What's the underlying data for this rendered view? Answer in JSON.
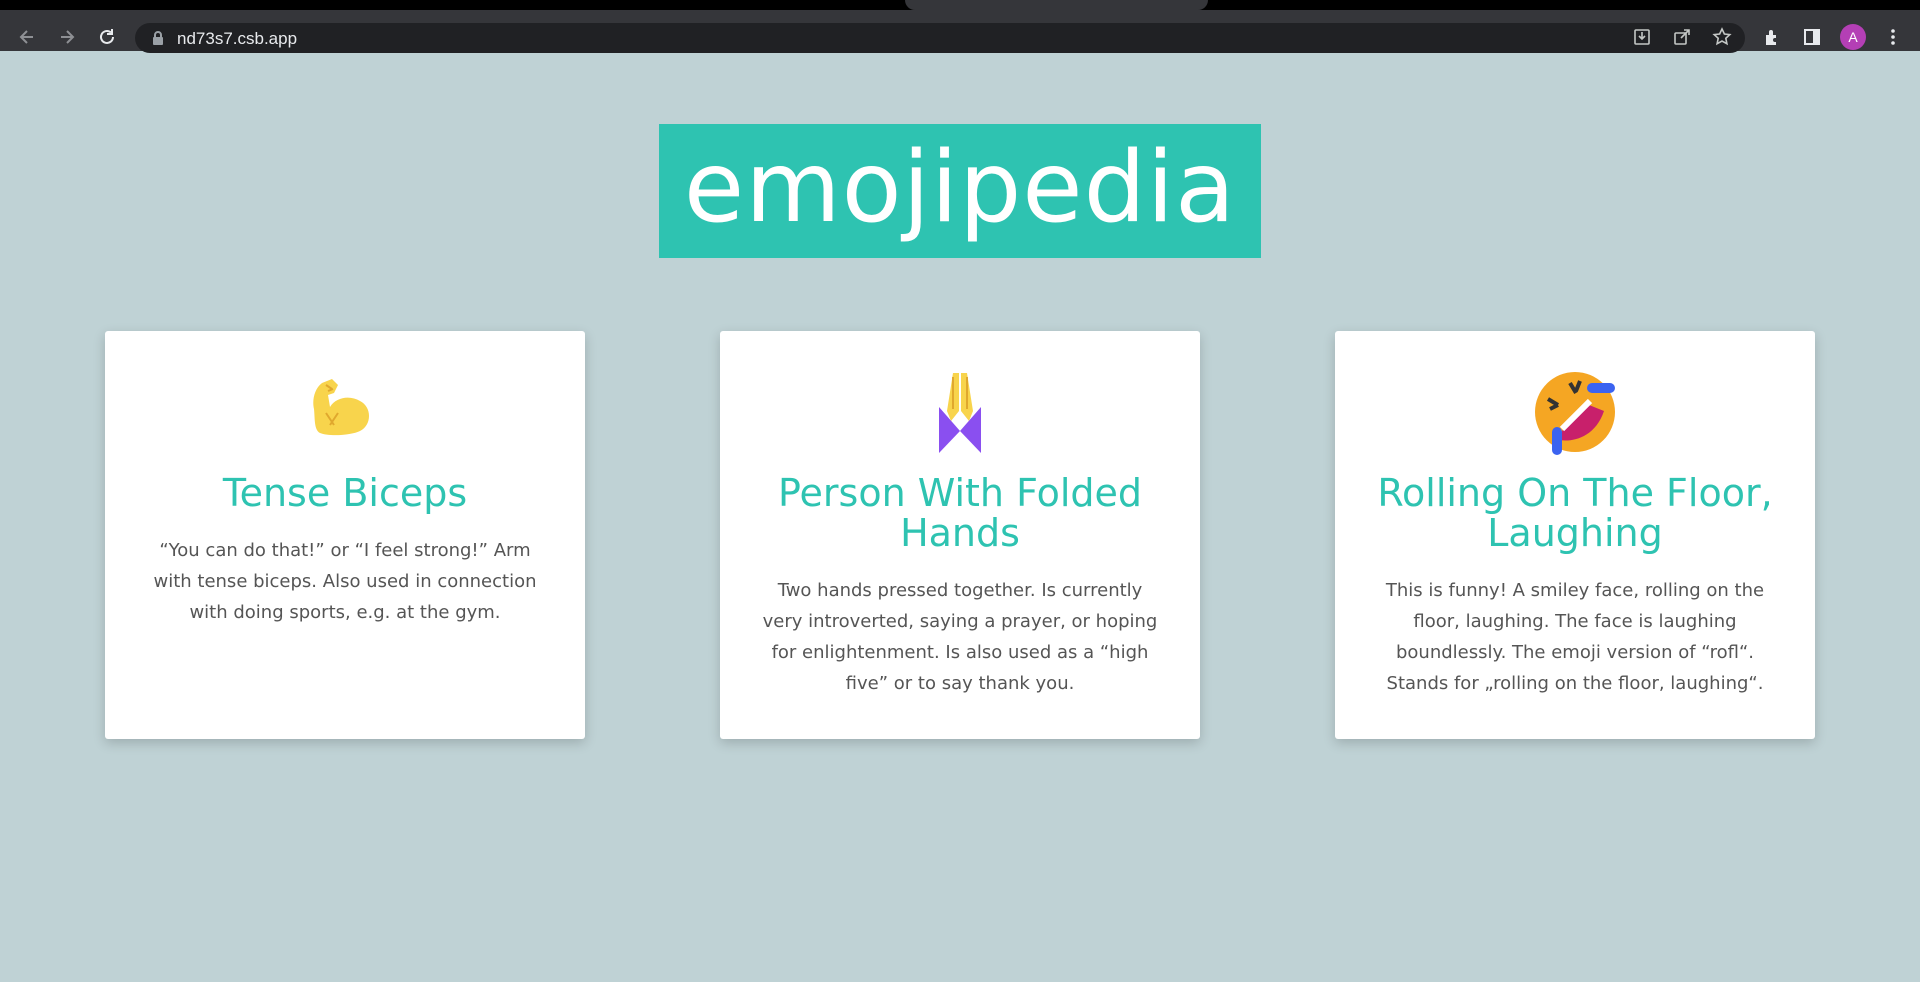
{
  "browser": {
    "url": "nd73s7.csb.app",
    "avatar_initial": "A"
  },
  "page": {
    "title": "emojipedia",
    "accent_color": "#2ec3b1",
    "background_color": "#bfd2d5"
  },
  "cards": [
    {
      "emoji_icon": "flexed-biceps-icon",
      "title": "Tense Biceps",
      "description": "“You can do that!” or “I feel strong!” Arm with tense biceps. Also used in connection with doing sports, e.g. at the gym."
    },
    {
      "emoji_icon": "folded-hands-icon",
      "title": "Person With Folded Hands",
      "description": "Two hands pressed together. Is currently very introverted, saying a prayer, or hoping for enlightenment. Is also used as a “high five” or to say thank you."
    },
    {
      "emoji_icon": "rolling-on-the-floor-laughing-icon",
      "title": "Rolling On The Floor, Laughing",
      "description": "This is funny! A smiley face, rolling on the floor, laughing. The face is laughing boundlessly. The emoji version of “rofl“. Stands for „rolling on the floor, laughing“."
    }
  ]
}
